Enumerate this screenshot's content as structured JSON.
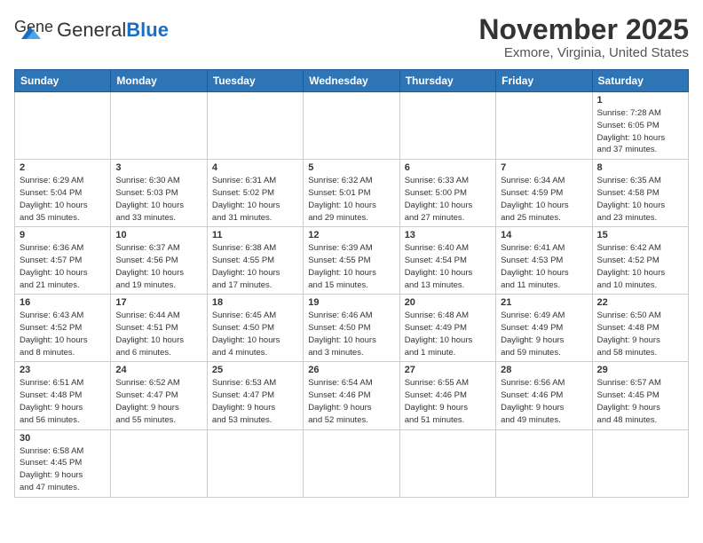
{
  "header": {
    "logo_general": "General",
    "logo_blue": "Blue",
    "month_title": "November 2025",
    "location": "Exmore, Virginia, United States"
  },
  "weekdays": [
    "Sunday",
    "Monday",
    "Tuesday",
    "Wednesday",
    "Thursday",
    "Friday",
    "Saturday"
  ],
  "weeks": [
    [
      {
        "day": "",
        "info": ""
      },
      {
        "day": "",
        "info": ""
      },
      {
        "day": "",
        "info": ""
      },
      {
        "day": "",
        "info": ""
      },
      {
        "day": "",
        "info": ""
      },
      {
        "day": "",
        "info": ""
      },
      {
        "day": "1",
        "info": "Sunrise: 7:28 AM\nSunset: 6:05 PM\nDaylight: 10 hours\nand 37 minutes."
      }
    ],
    [
      {
        "day": "2",
        "info": "Sunrise: 6:29 AM\nSunset: 5:04 PM\nDaylight: 10 hours\nand 35 minutes."
      },
      {
        "day": "3",
        "info": "Sunrise: 6:30 AM\nSunset: 5:03 PM\nDaylight: 10 hours\nand 33 minutes."
      },
      {
        "day": "4",
        "info": "Sunrise: 6:31 AM\nSunset: 5:02 PM\nDaylight: 10 hours\nand 31 minutes."
      },
      {
        "day": "5",
        "info": "Sunrise: 6:32 AM\nSunset: 5:01 PM\nDaylight: 10 hours\nand 29 minutes."
      },
      {
        "day": "6",
        "info": "Sunrise: 6:33 AM\nSunset: 5:00 PM\nDaylight: 10 hours\nand 27 minutes."
      },
      {
        "day": "7",
        "info": "Sunrise: 6:34 AM\nSunset: 4:59 PM\nDaylight: 10 hours\nand 25 minutes."
      },
      {
        "day": "8",
        "info": "Sunrise: 6:35 AM\nSunset: 4:58 PM\nDaylight: 10 hours\nand 23 minutes."
      }
    ],
    [
      {
        "day": "9",
        "info": "Sunrise: 6:36 AM\nSunset: 4:57 PM\nDaylight: 10 hours\nand 21 minutes."
      },
      {
        "day": "10",
        "info": "Sunrise: 6:37 AM\nSunset: 4:56 PM\nDaylight: 10 hours\nand 19 minutes."
      },
      {
        "day": "11",
        "info": "Sunrise: 6:38 AM\nSunset: 4:55 PM\nDaylight: 10 hours\nand 17 minutes."
      },
      {
        "day": "12",
        "info": "Sunrise: 6:39 AM\nSunset: 4:55 PM\nDaylight: 10 hours\nand 15 minutes."
      },
      {
        "day": "13",
        "info": "Sunrise: 6:40 AM\nSunset: 4:54 PM\nDaylight: 10 hours\nand 13 minutes."
      },
      {
        "day": "14",
        "info": "Sunrise: 6:41 AM\nSunset: 4:53 PM\nDaylight: 10 hours\nand 11 minutes."
      },
      {
        "day": "15",
        "info": "Sunrise: 6:42 AM\nSunset: 4:52 PM\nDaylight: 10 hours\nand 10 minutes."
      }
    ],
    [
      {
        "day": "16",
        "info": "Sunrise: 6:43 AM\nSunset: 4:52 PM\nDaylight: 10 hours\nand 8 minutes."
      },
      {
        "day": "17",
        "info": "Sunrise: 6:44 AM\nSunset: 4:51 PM\nDaylight: 10 hours\nand 6 minutes."
      },
      {
        "day": "18",
        "info": "Sunrise: 6:45 AM\nSunset: 4:50 PM\nDaylight: 10 hours\nand 4 minutes."
      },
      {
        "day": "19",
        "info": "Sunrise: 6:46 AM\nSunset: 4:50 PM\nDaylight: 10 hours\nand 3 minutes."
      },
      {
        "day": "20",
        "info": "Sunrise: 6:48 AM\nSunset: 4:49 PM\nDaylight: 10 hours\nand 1 minute."
      },
      {
        "day": "21",
        "info": "Sunrise: 6:49 AM\nSunset: 4:49 PM\nDaylight: 9 hours\nand 59 minutes."
      },
      {
        "day": "22",
        "info": "Sunrise: 6:50 AM\nSunset: 4:48 PM\nDaylight: 9 hours\nand 58 minutes."
      }
    ],
    [
      {
        "day": "23",
        "info": "Sunrise: 6:51 AM\nSunset: 4:48 PM\nDaylight: 9 hours\nand 56 minutes."
      },
      {
        "day": "24",
        "info": "Sunrise: 6:52 AM\nSunset: 4:47 PM\nDaylight: 9 hours\nand 55 minutes."
      },
      {
        "day": "25",
        "info": "Sunrise: 6:53 AM\nSunset: 4:47 PM\nDaylight: 9 hours\nand 53 minutes."
      },
      {
        "day": "26",
        "info": "Sunrise: 6:54 AM\nSunset: 4:46 PM\nDaylight: 9 hours\nand 52 minutes."
      },
      {
        "day": "27",
        "info": "Sunrise: 6:55 AM\nSunset: 4:46 PM\nDaylight: 9 hours\nand 51 minutes."
      },
      {
        "day": "28",
        "info": "Sunrise: 6:56 AM\nSunset: 4:46 PM\nDaylight: 9 hours\nand 49 minutes."
      },
      {
        "day": "29",
        "info": "Sunrise: 6:57 AM\nSunset: 4:45 PM\nDaylight: 9 hours\nand 48 minutes."
      }
    ],
    [
      {
        "day": "30",
        "info": "Sunrise: 6:58 AM\nSunset: 4:45 PM\nDaylight: 9 hours\nand 47 minutes."
      },
      {
        "day": "",
        "info": ""
      },
      {
        "day": "",
        "info": ""
      },
      {
        "day": "",
        "info": ""
      },
      {
        "day": "",
        "info": ""
      },
      {
        "day": "",
        "info": ""
      },
      {
        "day": "",
        "info": ""
      }
    ]
  ]
}
